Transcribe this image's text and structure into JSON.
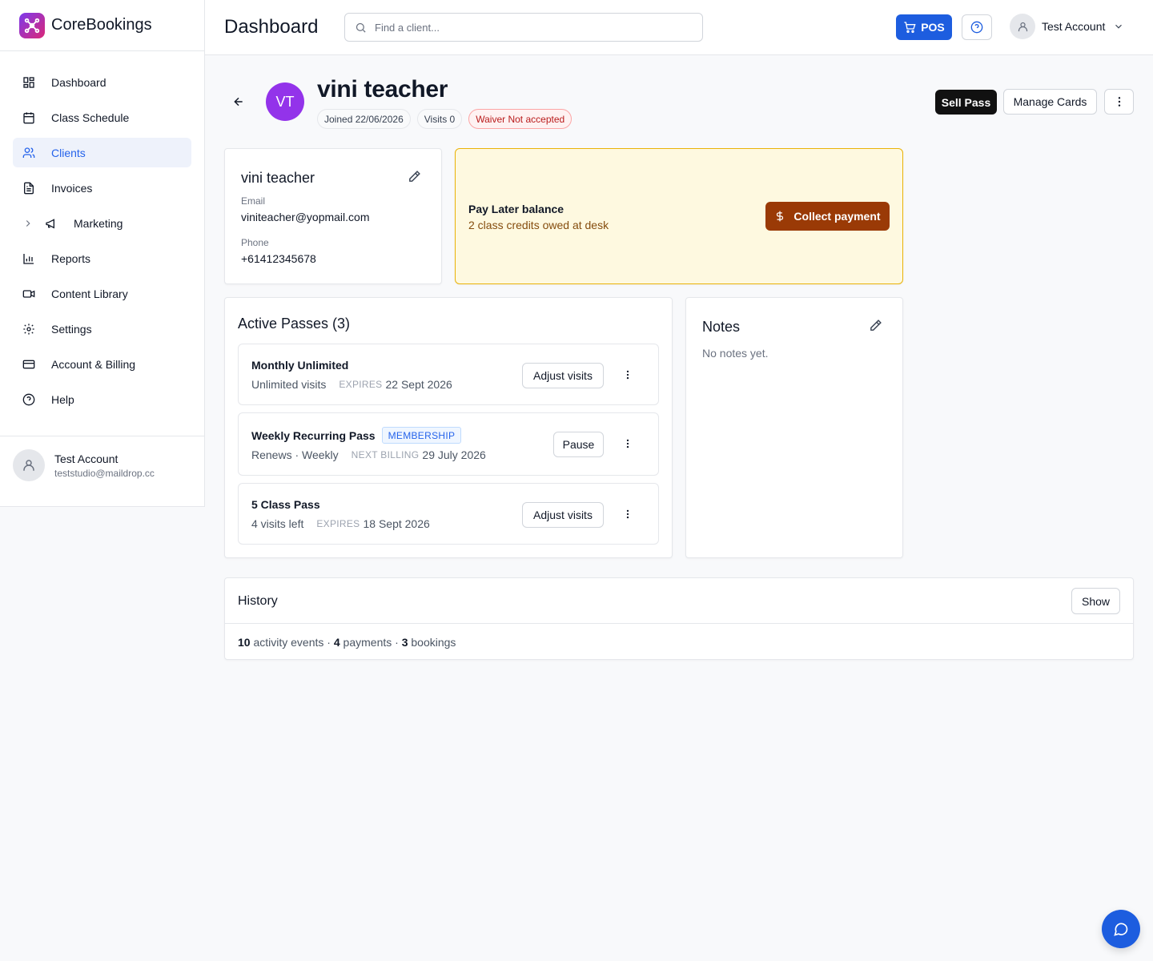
{
  "brand": {
    "name": "CoreBookings"
  },
  "sidebar": {
    "items": [
      {
        "label": "Dashboard",
        "icon": "grid-icon"
      },
      {
        "label": "Class Schedule",
        "icon": "calendar-icon"
      },
      {
        "label": "Clients",
        "icon": "users-icon",
        "active": true
      },
      {
        "label": "Invoices",
        "icon": "document-icon"
      },
      {
        "label": "Marketing",
        "icon": "megaphone-icon"
      },
      {
        "label": "Reports",
        "icon": "bar-chart-icon"
      },
      {
        "label": "Content Library",
        "icon": "video-icon"
      },
      {
        "label": "Settings",
        "icon": "gear-icon"
      },
      {
        "label": "Account & Billing",
        "icon": "credit-card-icon"
      },
      {
        "label": "Help",
        "icon": "help-circle-icon"
      }
    ],
    "user": {
      "name": "Test Account",
      "email": "teststudio@maildrop.cc"
    }
  },
  "header": {
    "title": "Dashboard",
    "search_placeholder": "Find a client...",
    "pos_label": "POS",
    "account_name": "Test Account"
  },
  "client": {
    "initials": "VT",
    "name": "vini teacher",
    "chips": {
      "joined": "Joined 22/06/2026",
      "visits": "Visits 0",
      "waiver": "Waiver Not accepted"
    },
    "actions": {
      "sell": "Sell Pass",
      "cards": "Manage Cards"
    },
    "contact": {
      "name": "vini teacher",
      "email_label": "Email",
      "email": "viniteacher@yopmail.com",
      "phone_label": "Phone",
      "phone": "+61412345678"
    }
  },
  "paylater": {
    "title": "Pay Later balance",
    "subtitle": "2 class credits owed at desk",
    "button": "Collect payment"
  },
  "passes": {
    "title": "Active Passes (3)",
    "items": [
      {
        "name": "Monthly Unlimited",
        "desc": "Unlimited visits",
        "key": "EXPIRES",
        "date": "22 Sept 2026",
        "action": "Adjust visits"
      },
      {
        "name": "Weekly Recurring Pass",
        "badge": "MEMBERSHIP",
        "desc": "Renews · Weekly",
        "key": "NEXT BILLING",
        "date": "29 July 2026",
        "action": "Pause"
      },
      {
        "name": "5 Class Pass",
        "desc": "4 visits left",
        "key": "EXPIRES",
        "date": "18 Sept 2026",
        "action": "Adjust visits"
      }
    ]
  },
  "notes": {
    "title": "Notes",
    "empty": "No notes yet."
  },
  "history": {
    "title": "History",
    "button": "Show",
    "events_count": "10",
    "events_label": "activity events",
    "payments_count": "4",
    "payments_label": "payments",
    "bookings_count": "3",
    "bookings_label": "bookings",
    "separator": "·"
  },
  "colors": {
    "primary": "#1d5ddf",
    "active_bg": "#eef2fb",
    "avatar": "#9333ea",
    "collect": "#9a3a06",
    "paylater_bg": "#fef9e0"
  }
}
